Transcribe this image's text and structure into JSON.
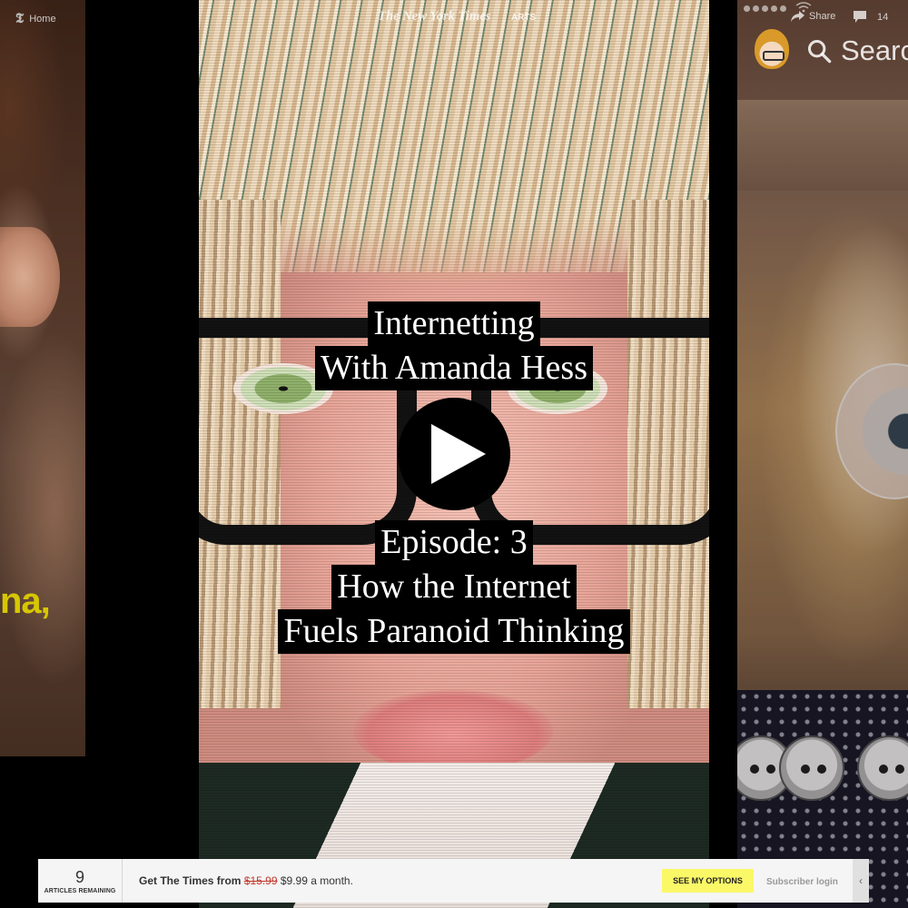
{
  "topbar": {
    "home_label": "Home",
    "brand": "The New York Times",
    "section": "ARTS",
    "share_label": "Share",
    "comment_count": "14"
  },
  "side_content": {
    "left_caption": "na,",
    "right_search_text": "Searc"
  },
  "video": {
    "title_lines": [
      "Internetting",
      "With Amanda Hess"
    ],
    "episode_lines": [
      "Episode: 3",
      "How the Internet",
      "Fuels Paranoid Thinking"
    ]
  },
  "promo": {
    "articles_count": "9",
    "articles_label": "ARTICLES REMAINING",
    "lead": "Get The Times from",
    "old_price": "$15.99",
    "new_price": "$9.99 a month.",
    "options_button": "SEE MY OPTIONS",
    "subscriber_login": "Subscriber login",
    "collapse_glyph": "‹"
  },
  "colors": {
    "options_button_bg": "#fbf868",
    "old_price": "#c0392b",
    "left_caption": "#d7c600"
  },
  "icons": [
    "nyt-t-icon",
    "share-arrow-icon",
    "comment-icon",
    "wifi-icon",
    "search-icon",
    "play-icon",
    "chevron-left-icon"
  ]
}
